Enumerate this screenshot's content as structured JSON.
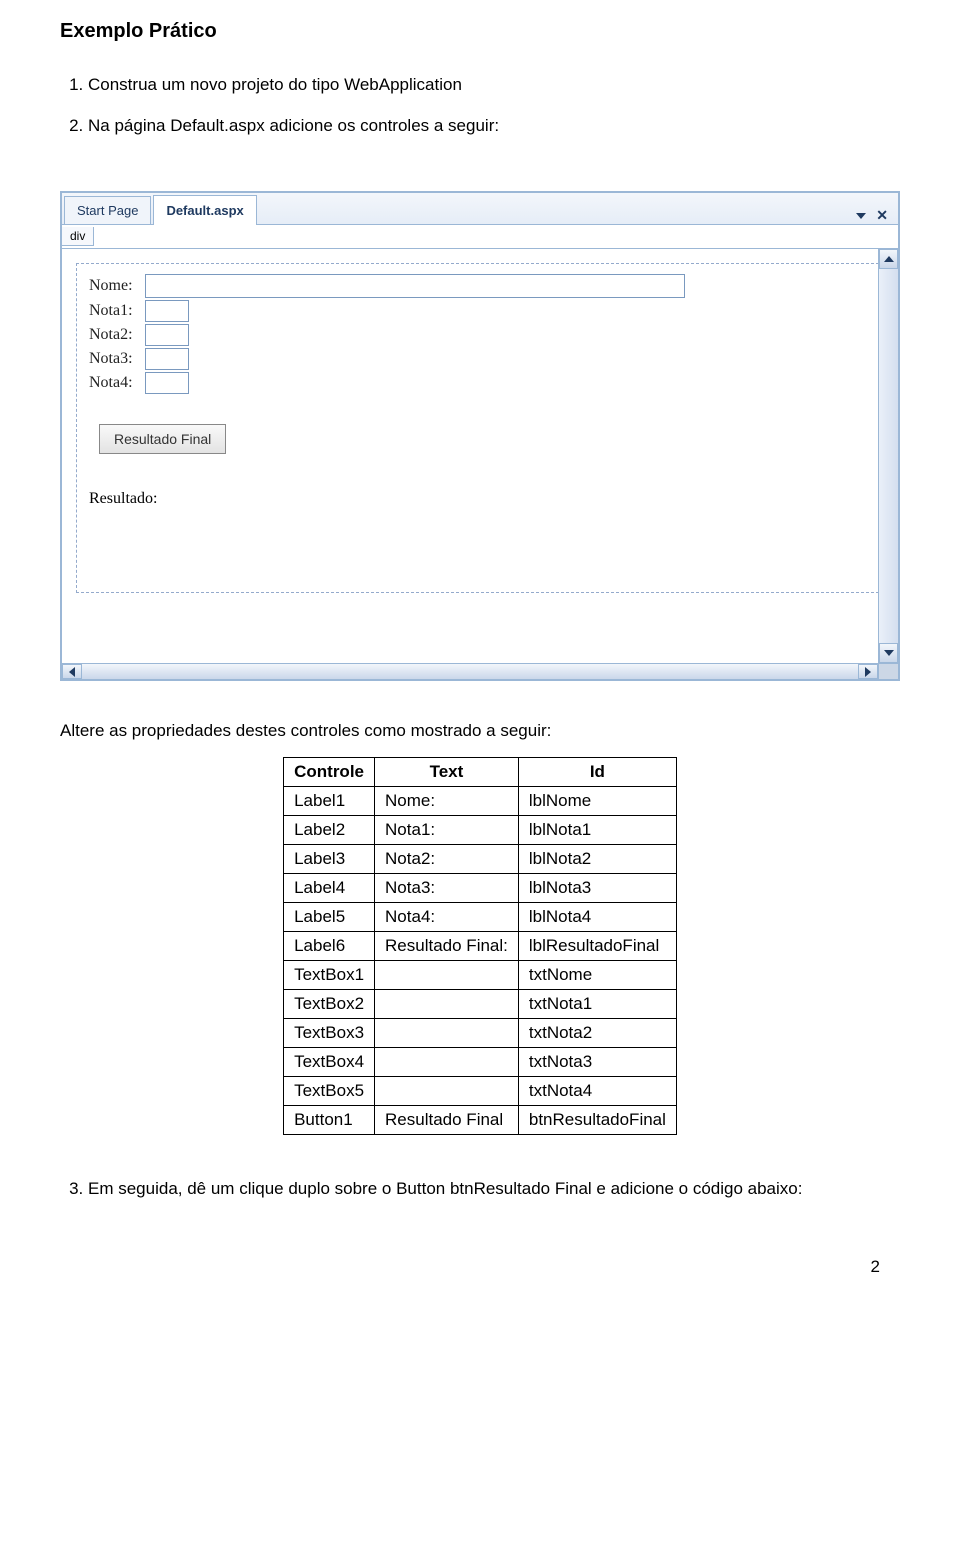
{
  "title": "Exemplo Prático",
  "steps": {
    "s1": "Construa um novo projeto do tipo WebApplication",
    "s2": "Na página Default.aspx adicione os controles a seguir:",
    "s3": "Em seguida, dê um clique duplo sobre o Button btnResultado Final e adicione o código abaixo:"
  },
  "afterScreenshot": "Altere as propriedades destes controles como mostrado a seguir:",
  "tabs": {
    "startPage": "Start Page",
    "defaultAspx": "Default.aspx"
  },
  "breadcrumb": "div",
  "designer": {
    "labels": {
      "nome": "Nome:",
      "nota1": "Nota1:",
      "nota2": "Nota2:",
      "nota3": "Nota3:",
      "nota4": "Nota4:",
      "resultado": "Resultado:"
    },
    "buttonResultadoFinal": "Resultado Final"
  },
  "table": {
    "headers": {
      "controle": "Controle",
      "text": "Text",
      "id": "Id"
    },
    "rows": [
      {
        "controle": "Label1",
        "text": "Nome:",
        "id": "lblNome"
      },
      {
        "controle": "Label2",
        "text": "Nota1:",
        "id": "lblNota1"
      },
      {
        "controle": "Label3",
        "text": "Nota2:",
        "id": "lblNota2"
      },
      {
        "controle": "Label4",
        "text": "Nota3:",
        "id": "lblNota3"
      },
      {
        "controle": "Label5",
        "text": "Nota4:",
        "id": "lblNota4"
      },
      {
        "controle": "Label6",
        "text": "Resultado Final:",
        "id": "lblResultadoFinal"
      },
      {
        "controle": "TextBox1",
        "text": "",
        "id": "txtNome"
      },
      {
        "controle": "TextBox2",
        "text": "",
        "id": "txtNota1"
      },
      {
        "controle": "TextBox3",
        "text": "",
        "id": "txtNota2"
      },
      {
        "controle": "TextBox4",
        "text": "",
        "id": "txtNota3"
      },
      {
        "controle": "TextBox5",
        "text": "",
        "id": "txtNota4"
      },
      {
        "controle": "Button1",
        "text": "Resultado Final",
        "id": "btnResultadoFinal"
      }
    ]
  },
  "pageNumber": "2"
}
